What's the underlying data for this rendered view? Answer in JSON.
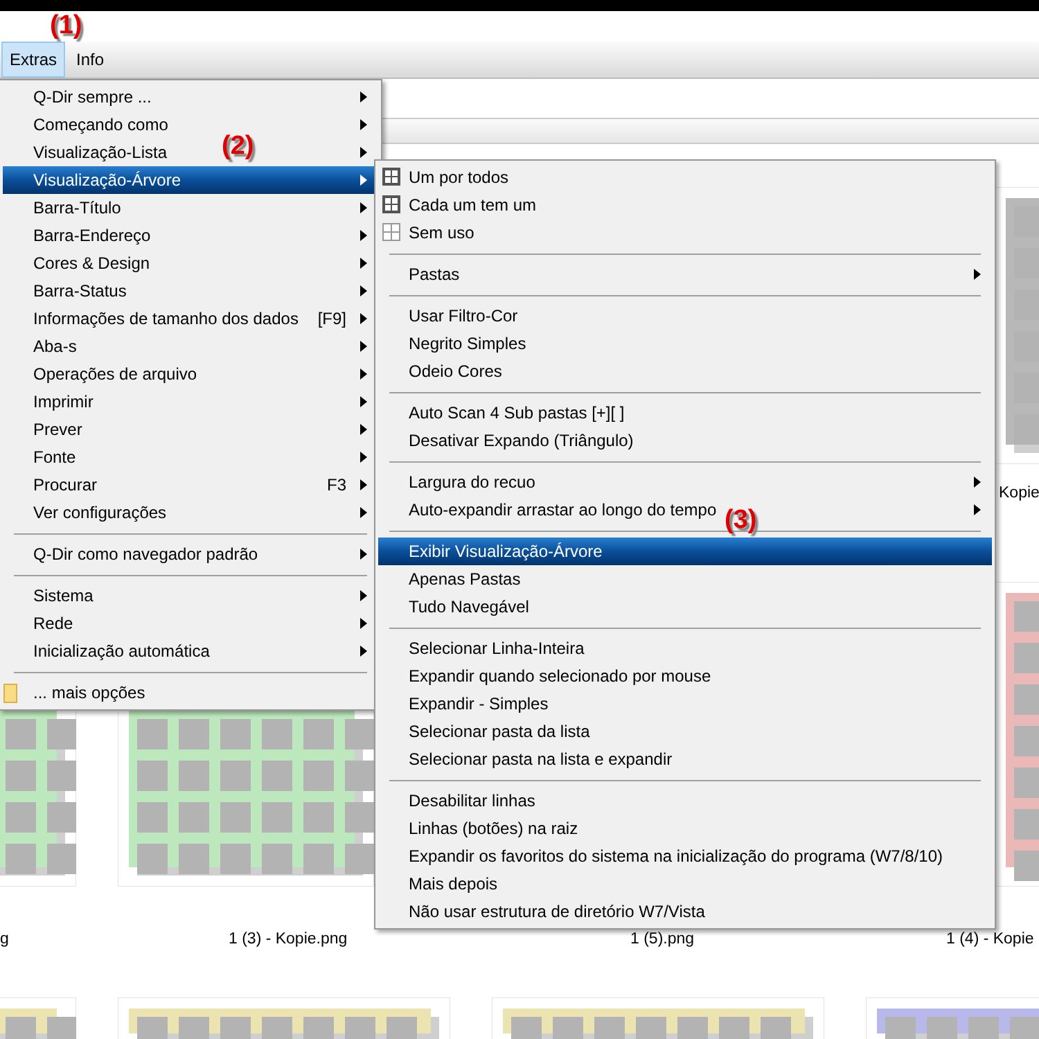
{
  "menubar": [
    {
      "label": "Extras",
      "selected": true
    },
    {
      "label": "Info",
      "selected": false
    }
  ],
  "annotations": [
    {
      "text": "(1)"
    },
    {
      "text": "(2)"
    },
    {
      "text": "(3)"
    }
  ],
  "thumbnails": [
    {
      "color": "#b8b8b8"
    },
    {
      "color": "#bde8bd"
    },
    {
      "color": "#bde8bd"
    },
    {
      "color": "#ebb8b8"
    },
    {
      "color": "#ebe3b0"
    },
    {
      "color": "#ebe3b0"
    },
    {
      "color": "#ebe3b0"
    },
    {
      "color": "#b8b8ea"
    }
  ],
  "captions": [
    "Kopie",
    "g",
    "1 (3) - Kopie.png",
    "1 (5).png",
    "1 (4) - Kopie"
  ],
  "menu": [
    {
      "kind": "item",
      "label": "Q-Dir sempre ...",
      "submenu": true,
      "selected": false
    },
    {
      "kind": "item",
      "label": "Começando como",
      "submenu": true,
      "selected": false
    },
    {
      "kind": "item",
      "label": "Visualização-Lista",
      "submenu": true,
      "selected": false
    },
    {
      "kind": "item",
      "label": "Visualização-Árvore",
      "submenu": true,
      "selected": true
    },
    {
      "kind": "item",
      "label": "Barra-Título",
      "submenu": true,
      "selected": false
    },
    {
      "kind": "item",
      "label": "Barra-Endereço",
      "submenu": true,
      "selected": false
    },
    {
      "kind": "item",
      "label": "Cores & Design",
      "submenu": true,
      "selected": false
    },
    {
      "kind": "item",
      "label": "Barra-Status",
      "submenu": true,
      "selected": false
    },
    {
      "kind": "item",
      "label": "Informações de tamanho dos dados",
      "shortcut": "[F9]",
      "submenu": true,
      "selected": false
    },
    {
      "kind": "item",
      "label": "Aba-s",
      "submenu": true,
      "selected": false
    },
    {
      "kind": "item",
      "label": "Operações de arquivo",
      "submenu": true,
      "selected": false
    },
    {
      "kind": "item",
      "label": "Imprimir",
      "submenu": true,
      "selected": false
    },
    {
      "kind": "item",
      "label": "Prever",
      "submenu": true,
      "selected": false
    },
    {
      "kind": "item",
      "label": "Fonte",
      "submenu": true,
      "selected": false
    },
    {
      "kind": "item",
      "label": "Procurar",
      "shortcut": "F3",
      "submenu": true,
      "selected": false
    },
    {
      "kind": "item",
      "label": "Ver configurações",
      "submenu": true,
      "selected": false
    },
    {
      "kind": "separator"
    },
    {
      "kind": "item",
      "label": "Q-Dir como navegador padrão",
      "submenu": true,
      "selected": false
    },
    {
      "kind": "separator"
    },
    {
      "kind": "item",
      "label": "Sistema",
      "submenu": true,
      "selected": false
    },
    {
      "kind": "item",
      "label": "Rede",
      "submenu": true,
      "selected": false
    },
    {
      "kind": "item",
      "label": "Inicialização automática",
      "submenu": true,
      "selected": false
    },
    {
      "kind": "separator"
    },
    {
      "kind": "folder",
      "label": "... mais opções",
      "submenu": false,
      "selected": false
    }
  ],
  "submenu": [
    {
      "kind": "grid",
      "label": "Um por todos",
      "checked": true,
      "selected": false
    },
    {
      "kind": "grid",
      "label": "Cada um tem um",
      "checked": true,
      "selected": false
    },
    {
      "kind": "grid",
      "label": "Sem uso",
      "checked": false,
      "selected": false
    },
    {
      "kind": "separator"
    },
    {
      "kind": "item",
      "label": "Pastas",
      "submenu": true,
      "selected": false
    },
    {
      "kind": "separator"
    },
    {
      "kind": "item",
      "label": "Usar Filtro-Cor",
      "submenu": false,
      "selected": false
    },
    {
      "kind": "item",
      "label": "Negrito Simples",
      "submenu": false,
      "selected": false
    },
    {
      "kind": "item",
      "label": "Odeio Cores",
      "submenu": false,
      "selected": false
    },
    {
      "kind": "separator"
    },
    {
      "kind": "item",
      "label": "Auto Scan 4 Sub pastas [+][ ]",
      "submenu": false,
      "selected": false
    },
    {
      "kind": "item",
      "label": "Desativar Expando (Triângulo)",
      "submenu": false,
      "selected": false
    },
    {
      "kind": "separator"
    },
    {
      "kind": "item",
      "label": "Largura do recuo",
      "submenu": true,
      "selected": false
    },
    {
      "kind": "item",
      "label": "Auto-expandir arrastar ao longo do tempo",
      "submenu": true,
      "selected": false
    },
    {
      "kind": "separator"
    },
    {
      "kind": "item",
      "label": "Exibir Visualização-Árvore",
      "submenu": false,
      "selected": true
    },
    {
      "kind": "item",
      "label": "Apenas Pastas",
      "submenu": false,
      "selected": false
    },
    {
      "kind": "item",
      "label": "Tudo Navegável",
      "submenu": false,
      "selected": false
    },
    {
      "kind": "separator"
    },
    {
      "kind": "item",
      "label": "Selecionar Linha-Inteira",
      "submenu": false,
      "selected": false
    },
    {
      "kind": "item",
      "label": "Expandir quando selecionado por mouse",
      "submenu": false,
      "selected": false
    },
    {
      "kind": "item",
      "label": "Expandir - Simples",
      "submenu": false,
      "selected": false
    },
    {
      "kind": "item",
      "label": "Selecionar pasta da lista",
      "submenu": false,
      "selected": false
    },
    {
      "kind": "item",
      "label": "Selecionar pasta na lista e expandir",
      "submenu": false,
      "selected": false
    },
    {
      "kind": "separator"
    },
    {
      "kind": "item",
      "label": "Desabilitar linhas",
      "submenu": false,
      "selected": false
    },
    {
      "kind": "item",
      "label": "Linhas (botões) na raiz",
      "submenu": false,
      "selected": false
    },
    {
      "kind": "item",
      "label": "Expandir os favoritos do sistema na inicialização do programa (W7/8/10)",
      "submenu": false,
      "selected": false
    },
    {
      "kind": "item",
      "label": "Mais depois",
      "submenu": false,
      "selected": false
    },
    {
      "kind": "item",
      "label": "Não usar estrutura de diretório W7/Vista",
      "submenu": false,
      "selected": false
    }
  ]
}
